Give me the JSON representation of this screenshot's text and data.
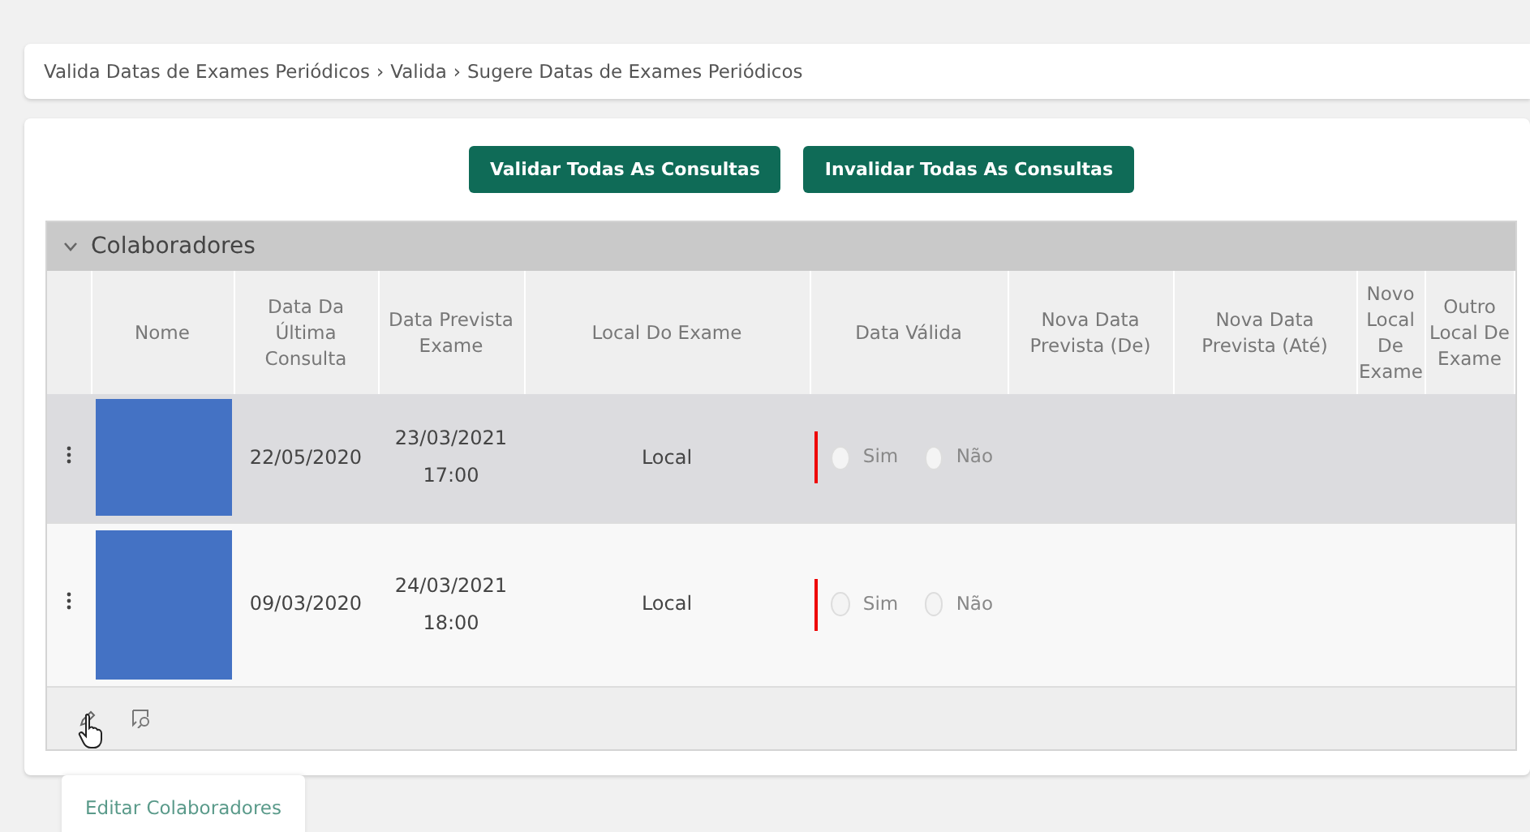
{
  "breadcrumb": [
    {
      "label": "Valida Datas de Exames Periódicos"
    },
    {
      "label": "Valida"
    },
    {
      "label": "Sugere Datas de Exames Periódicos"
    }
  ],
  "breadcrumb_separator": "›",
  "actions": [
    "Validar Todas As Consultas",
    "Invalidar Todas As Consultas"
  ],
  "panel": {
    "title": "Colaboradores",
    "expanded": true,
    "columns": [
      "Nome",
      "Data Da Última Consulta",
      "Data Prevista Exame",
      "Local Do Exame",
      "Data Válida",
      "Nova Data Prevista (De)",
      "Nova Data Prevista (Até)",
      "Novo Local De Exame",
      "Outro Local De Exame"
    ],
    "rows": [
      {
        "selected": true,
        "last_consulta": "22/05/2020",
        "prevista": [
          "23/03/2021",
          "17:00"
        ],
        "local": "Local",
        "invalid": true,
        "options": [
          {
            "label": "Sim",
            "checked": false
          },
          {
            "label": "Não",
            "checked": false
          }
        ]
      },
      {
        "selected": false,
        "last_consulta": "09/03/2020",
        "prevista": [
          "24/03/2021",
          "18:00"
        ],
        "local": "Local",
        "invalid": true,
        "options": [
          {
            "label": "Sim",
            "checked": false
          },
          {
            "label": "Não",
            "checked": false
          }
        ]
      }
    ]
  },
  "tooltip": "Editar Colaboradores"
}
